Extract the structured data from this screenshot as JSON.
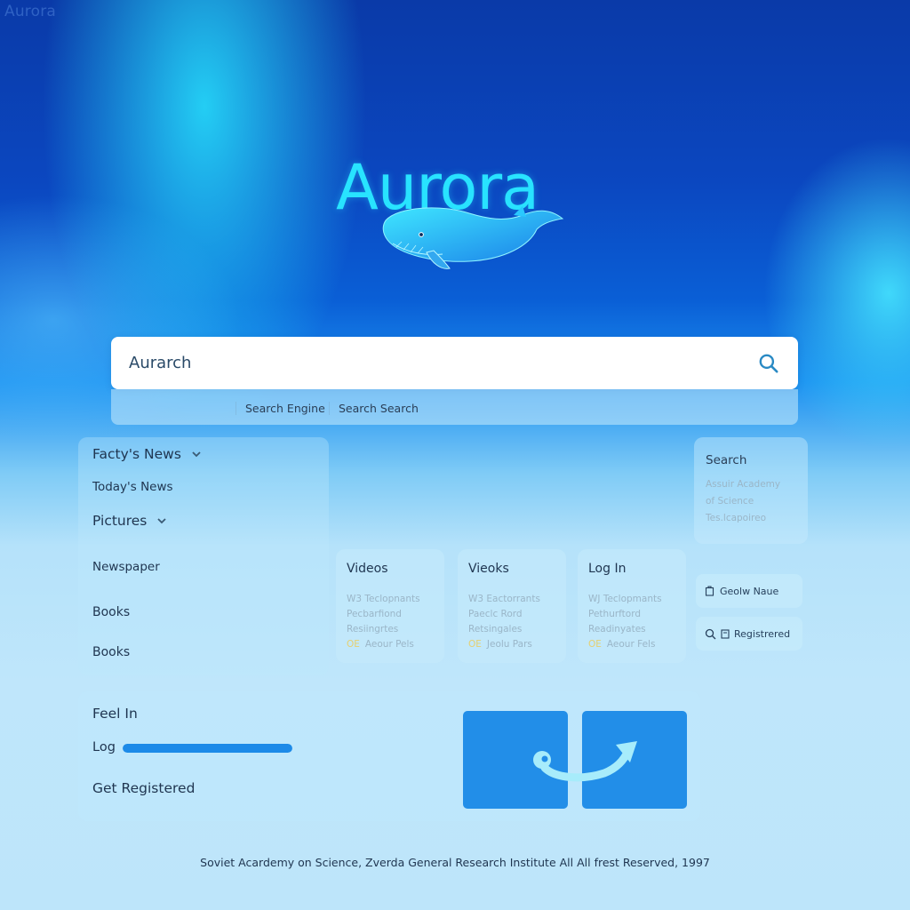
{
  "app": {
    "corner_title": "Aurora",
    "logo_title": "Aurora"
  },
  "search": {
    "value": "Aurarch",
    "placeholder": "",
    "button_icon": "search-icon",
    "suggestions": [
      "Search Engine",
      "Search Search"
    ]
  },
  "nav": {
    "items": [
      {
        "label": "Facty's News",
        "has_chevron": true
      },
      {
        "label": "Today's News",
        "has_chevron": false
      },
      {
        "label": "Pictures",
        "has_chevron": true
      },
      {
        "label": "Newspaper",
        "has_chevron": false
      },
      {
        "label": "Books",
        "has_chevron": false
      },
      {
        "label": "Books",
        "has_chevron": false
      }
    ]
  },
  "cards": [
    {
      "title": "Videos",
      "lines": [
        "W3 Teclopnants",
        "Pecbarfiond",
        "Resiingrtes"
      ],
      "tag": "OE",
      "tag_text": "Aeour Pels"
    },
    {
      "title": "Vieoks",
      "lines": [
        "W3 Eactorrants",
        "Paeclc Rord",
        "Retsingales"
      ],
      "tag": "OE",
      "tag_text": "Jeolu Pars"
    },
    {
      "title": "Log In",
      "lines": [
        "WJ Teclopmants",
        "Pethurftord",
        "Readinyates"
      ],
      "tag": "OE",
      "tag_text": "Aeour Fels"
    }
  ],
  "side_search": {
    "title": "Search",
    "lines": [
      "Assuir Academy",
      "of Science",
      "Tes.lcapoireo"
    ]
  },
  "pills": [
    {
      "icon": "clipboard-icon",
      "label": "Geolw Naue"
    },
    {
      "icon": "search-icon",
      "icon2": "document-icon",
      "label": "Registrered"
    }
  ],
  "login": {
    "title": "Feel In",
    "progress_label": "Log",
    "progress_percent": 100,
    "register_label": "Get Registered"
  },
  "colors": {
    "accent": "#1c8ae8",
    "tile": "#228ee8",
    "logo": "#28e3ff"
  },
  "footer": {
    "text": "Soviet Acardemy on Science, Zverda General Research Institute All All frest Reserved, 1997"
  }
}
